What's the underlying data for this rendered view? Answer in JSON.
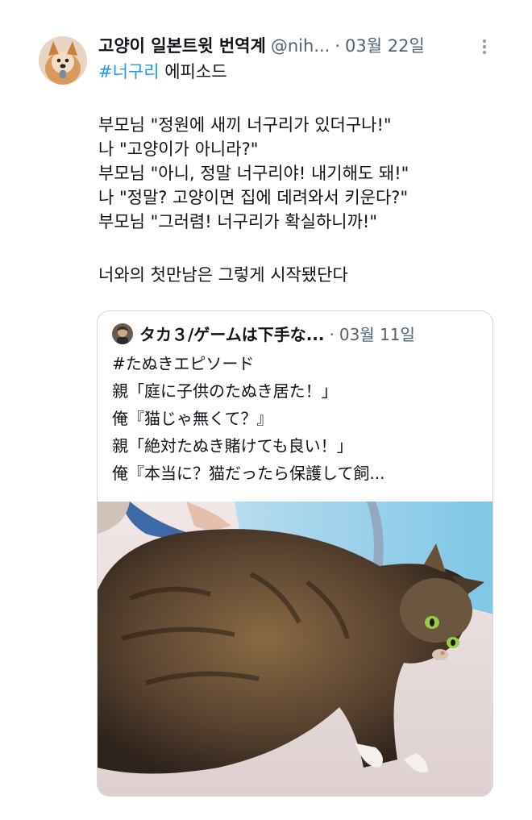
{
  "tweet": {
    "author_name": "고양이 일본트윗 번역계",
    "author_handle": "@nih...",
    "separator": "·",
    "date": "03월 22일",
    "hashtag": "#너구리",
    "title_rest": " 에피소드",
    "lines": [
      "부모님 \"정원에 새끼 너구리가 있더구나!\"",
      "나 \"고양이가 아니라?\"",
      "부모님 \"아니, 정말 너구리야! 내기해도 돼!\"",
      "나 \"정말? 고양이면 집에 데려와서 키운다?\"",
      "부모님 \"그러렴! 너구리가 확실하니까!\""
    ],
    "closing": "너와의 첫만남은 그렇게 시작됐단다"
  },
  "quote": {
    "author_name": "タカ３/ゲームは下手な...",
    "separator": "·",
    "date": "03월 11일",
    "lines": [
      "#たぬきエピソード",
      "親「庭に子供のたぬき居た！」",
      "俺『猫じゃ無くて？』",
      "親「絶対たぬき賭けても良い！」",
      "俺『本当に？猫だったら保護して飼..."
    ]
  },
  "icons": {
    "more": "more-vertical-icon",
    "avatar": "corgi-avatar",
    "quote_avatar": "profile-avatar"
  },
  "colors": {
    "text": "#0f1419",
    "secondary": "#536471",
    "link": "#1d9bf0",
    "border": "#cfd9de"
  }
}
